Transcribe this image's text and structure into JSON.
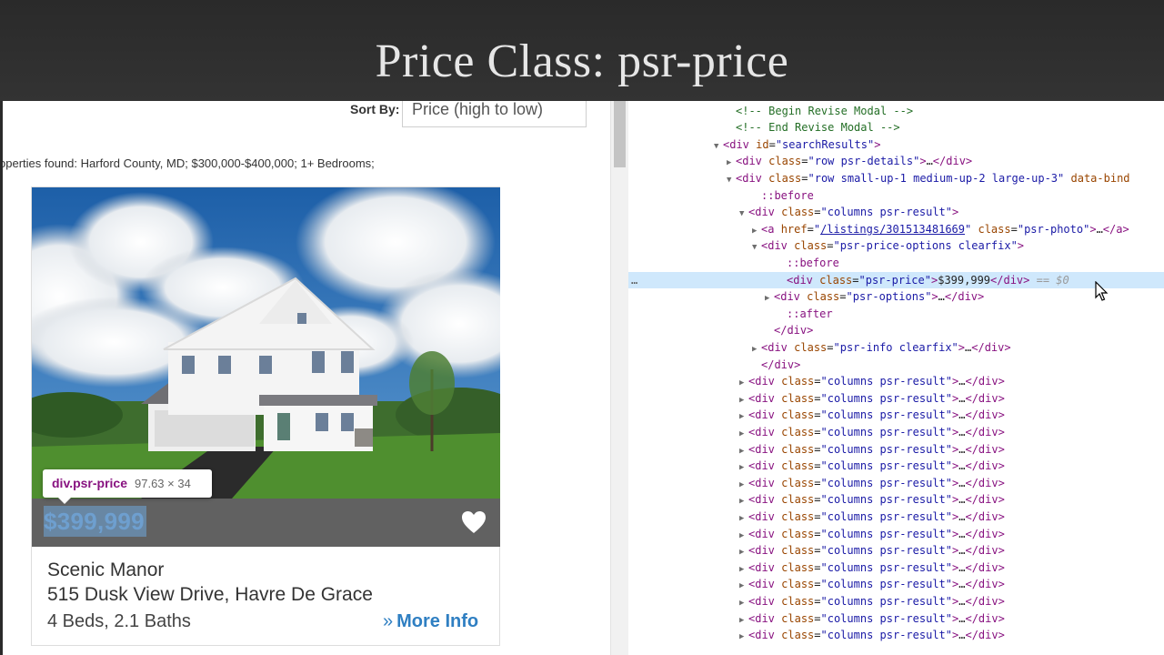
{
  "slide": {
    "title": "Price Class: psr-price"
  },
  "page": {
    "sort_label": "Sort By:",
    "sort_value": "Price (high to low)",
    "found_text": "operties found: Harford County, MD; $300,000-$400,000; 1+ Bedrooms;",
    "listing": {
      "price": "$399,999",
      "name": "Scenic Manor",
      "address": "515 Dusk View Drive, Havre De Grace",
      "beds_baths": "4 Beds, 2.1 Baths",
      "more_info": "More Info"
    },
    "inspector_tooltip": {
      "selector": "div.psr-price",
      "size": "97.63 × 34"
    }
  },
  "devtools": {
    "ellipsis": "…",
    "selected_marker": "== $0",
    "lines": [
      {
        "indent": 8,
        "toggle": "",
        "html": "<span class='c'>&lt;!-- Begin Revise Modal --&gt;</span>"
      },
      {
        "indent": 8,
        "toggle": "",
        "html": "<span class='c'>&lt;!-- End Revise Modal --&gt;</span>"
      },
      {
        "indent": 7,
        "toggle": "open",
        "html": "<span class='t'>&lt;div</span> <span class='a'>id</span>=<span class='v'>\"searchResults\"</span><span class='t'>&gt;</span>"
      },
      {
        "indent": 8,
        "toggle": "closed",
        "html": "<span class='t'>&lt;div</span> <span class='a'>class</span>=<span class='v'>\"row psr-details\"</span><span class='t'>&gt;</span>…<span class='t'>&lt;/div&gt;</span>"
      },
      {
        "indent": 8,
        "toggle": "open",
        "html": "<span class='t'>&lt;div</span> <span class='a'>class</span>=<span class='v'>\"row small-up-1 medium-up-2 large-up-3\"</span> <span class='a'>data-bind</span>"
      },
      {
        "indent": 10,
        "toggle": "",
        "html": "<span class='pe'>::before</span>"
      },
      {
        "indent": 9,
        "toggle": "open",
        "html": "<span class='t'>&lt;div</span> <span class='a'>class</span>=<span class='v'>\"columns psr-result\"</span><span class='t'>&gt;</span>"
      },
      {
        "indent": 10,
        "toggle": "closed",
        "html": "<span class='t'>&lt;a</span> <span class='a'>href</span>=<span class='v'>\"<span class='lnk'>/listings/301513481669</span>\"</span> <span class='a'>class</span>=<span class='v'>\"psr-photo\"</span><span class='t'>&gt;</span>…<span class='t'>&lt;/a&gt;</span>"
      },
      {
        "indent": 10,
        "toggle": "open",
        "html": "<span class='t'>&lt;div</span> <span class='a'>class</span>=<span class='v'>\"psr-price-options clearfix\"</span><span class='t'>&gt;</span>"
      },
      {
        "indent": 12,
        "toggle": "",
        "html": "<span class='pe'>::before</span>"
      },
      {
        "indent": 12,
        "toggle": "",
        "selected": true,
        "html": "<span class='t'>&lt;div</span> <span class='a'>class</span>=<span class='v'>\"psr-price\"</span><span class='t'>&gt;</span>$399,999<span class='t'>&lt;/div&gt;</span> <span class='sel-marker'>== $0</span>"
      },
      {
        "indent": 11,
        "toggle": "closed",
        "html": "<span class='t'>&lt;div</span> <span class='a'>class</span>=<span class='v'>\"psr-options\"</span><span class='t'>&gt;</span>…<span class='t'>&lt;/div&gt;</span>"
      },
      {
        "indent": 12,
        "toggle": "",
        "html": "<span class='pe'>::after</span>"
      },
      {
        "indent": 11,
        "toggle": "",
        "html": "<span class='t'>&lt;/div&gt;</span>"
      },
      {
        "indent": 10,
        "toggle": "closed",
        "html": "<span class='t'>&lt;div</span> <span class='a'>class</span>=<span class='v'>\"psr-info clearfix\"</span><span class='t'>&gt;</span>…<span class='t'>&lt;/div&gt;</span>"
      },
      {
        "indent": 10,
        "toggle": "",
        "html": "<span class='t'>&lt;/div&gt;</span>"
      },
      {
        "indent": 9,
        "toggle": "closed",
        "html": "<span class='t'>&lt;div</span> <span class='a'>class</span>=<span class='v'>\"columns psr-result\"</span><span class='t'>&gt;</span>…<span class='t'>&lt;/div&gt;</span>"
      },
      {
        "indent": 9,
        "toggle": "closed",
        "html": "<span class='t'>&lt;div</span> <span class='a'>class</span>=<span class='v'>\"columns psr-result\"</span><span class='t'>&gt;</span>…<span class='t'>&lt;/div&gt;</span>"
      },
      {
        "indent": 9,
        "toggle": "closed",
        "html": "<span class='t'>&lt;div</span> <span class='a'>class</span>=<span class='v'>\"columns psr-result\"</span><span class='t'>&gt;</span>…<span class='t'>&lt;/div&gt;</span>"
      },
      {
        "indent": 9,
        "toggle": "closed",
        "html": "<span class='t'>&lt;div</span> <span class='a'>class</span>=<span class='v'>\"columns psr-result\"</span><span class='t'>&gt;</span>…<span class='t'>&lt;/div&gt;</span>"
      },
      {
        "indent": 9,
        "toggle": "closed",
        "html": "<span class='t'>&lt;div</span> <span class='a'>class</span>=<span class='v'>\"columns psr-result\"</span><span class='t'>&gt;</span>…<span class='t'>&lt;/div&gt;</span>"
      },
      {
        "indent": 9,
        "toggle": "closed",
        "html": "<span class='t'>&lt;div</span> <span class='a'>class</span>=<span class='v'>\"columns psr-result\"</span><span class='t'>&gt;</span>…<span class='t'>&lt;/div&gt;</span>"
      },
      {
        "indent": 9,
        "toggle": "closed",
        "html": "<span class='t'>&lt;div</span> <span class='a'>class</span>=<span class='v'>\"columns psr-result\"</span><span class='t'>&gt;</span>…<span class='t'>&lt;/div&gt;</span>"
      },
      {
        "indent": 9,
        "toggle": "closed",
        "html": "<span class='t'>&lt;div</span> <span class='a'>class</span>=<span class='v'>\"columns psr-result\"</span><span class='t'>&gt;</span>…<span class='t'>&lt;/div&gt;</span>"
      },
      {
        "indent": 9,
        "toggle": "closed",
        "html": "<span class='t'>&lt;div</span> <span class='a'>class</span>=<span class='v'>\"columns psr-result\"</span><span class='t'>&gt;</span>…<span class='t'>&lt;/div&gt;</span>"
      },
      {
        "indent": 9,
        "toggle": "closed",
        "html": "<span class='t'>&lt;div</span> <span class='a'>class</span>=<span class='v'>\"columns psr-result\"</span><span class='t'>&gt;</span>…<span class='t'>&lt;/div&gt;</span>"
      },
      {
        "indent": 9,
        "toggle": "closed",
        "html": "<span class='t'>&lt;div</span> <span class='a'>class</span>=<span class='v'>\"columns psr-result\"</span><span class='t'>&gt;</span>…<span class='t'>&lt;/div&gt;</span>"
      },
      {
        "indent": 9,
        "toggle": "closed",
        "html": "<span class='t'>&lt;div</span> <span class='a'>class</span>=<span class='v'>\"columns psr-result\"</span><span class='t'>&gt;</span>…<span class='t'>&lt;/div&gt;</span>"
      },
      {
        "indent": 9,
        "toggle": "closed",
        "html": "<span class='t'>&lt;div</span> <span class='a'>class</span>=<span class='v'>\"columns psr-result\"</span><span class='t'>&gt;</span>…<span class='t'>&lt;/div&gt;</span>"
      },
      {
        "indent": 9,
        "toggle": "closed",
        "html": "<span class='t'>&lt;div</span> <span class='a'>class</span>=<span class='v'>\"columns psr-result\"</span><span class='t'>&gt;</span>…<span class='t'>&lt;/div&gt;</span>"
      },
      {
        "indent": 9,
        "toggle": "closed",
        "html": "<span class='t'>&lt;div</span> <span class='a'>class</span>=<span class='v'>\"columns psr-result\"</span><span class='t'>&gt;</span>…<span class='t'>&lt;/div&gt;</span>"
      },
      {
        "indent": 9,
        "toggle": "closed",
        "html": "<span class='t'>&lt;div</span> <span class='a'>class</span>=<span class='v'>\"columns psr-result\"</span><span class='t'>&gt;</span>…<span class='t'>&lt;/div&gt;</span>"
      }
    ]
  }
}
